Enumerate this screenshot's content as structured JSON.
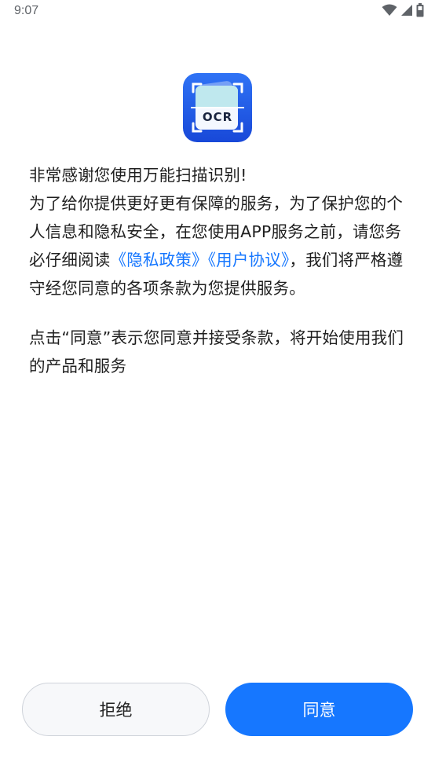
{
  "status_bar": {
    "time": "9:07",
    "icons": [
      "wifi-icon",
      "signal-icon",
      "battery-icon"
    ]
  },
  "app_icon": {
    "icon": "ocr-scan-icon",
    "label": "OCR",
    "colors": {
      "background_top": "#2b6cf0",
      "background_bottom": "#1a4fe0",
      "card": "#ffffff"
    }
  },
  "notice": {
    "greeting": "非常感谢您使用万能扫描识别!",
    "body_before_links": "为了给你提供更好更有保障的服务，为了保护您的个人信息和隐私安全，在您使用APP服务之前，请您务必仔细阅读",
    "privacy_link": "《隐私政策》",
    "user_agreement_link": "《用户协议》",
    "body_after_links": "，我们将严格遵守经您同意的各项条款为您提供服务。",
    "consent_text": "点击“同意”表示您同意并接受条款，将开始使用我们的产品和服务"
  },
  "buttons": {
    "reject_label": "拒绝",
    "agree_label": "同意"
  },
  "colors": {
    "accent": "#1677ff",
    "text": "#1f1f1f",
    "reject_bg": "#f7f8fa",
    "reject_border": "#cfd3da"
  }
}
